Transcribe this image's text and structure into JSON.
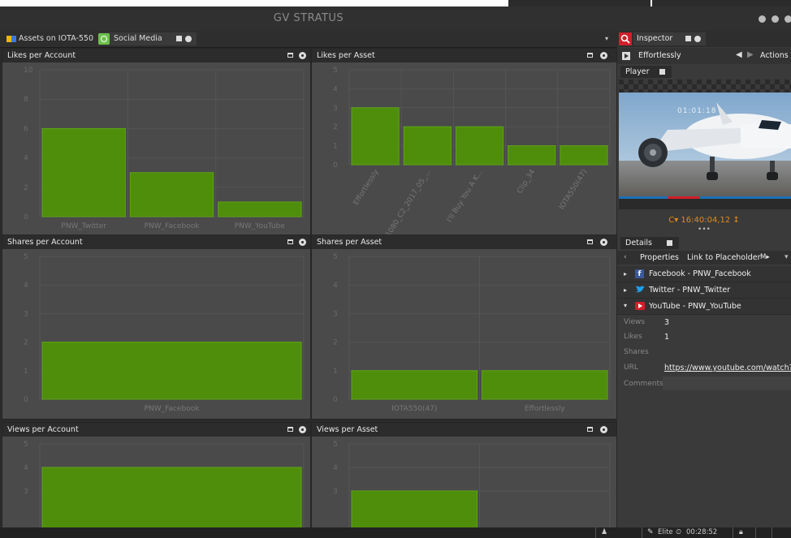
{
  "app": {
    "title": "GV STRATUS"
  },
  "tabs": [
    {
      "label": "Assets on IOTA-550",
      "active": false
    },
    {
      "label": "Social Media",
      "active": true
    }
  ],
  "colors": {
    "bar": "#4e8e0b",
    "bar_edge": "#5da514",
    "panel_bg": "#4a4a4a",
    "header_bg": "#2c2c2c",
    "grid": "#555555",
    "accent_red": "#d21e2b",
    "accent_green": "#6cc04a",
    "timecode": "#e08a1a"
  },
  "panels": [
    {
      "title": "Likes per Account",
      "chart_data": {
        "type": "bar",
        "categories": [
          "PNW_Twitter",
          "PNW_Facebook",
          "PNW_YouTube"
        ],
        "values": [
          6,
          3,
          1
        ],
        "ylim": [
          0,
          10
        ],
        "yticks": [
          0,
          2,
          4,
          6,
          8,
          10
        ],
        "rotate_labels": false
      }
    },
    {
      "title": "Likes per Asset",
      "chart_data": {
        "type": "bar",
        "categories": [
          "Effortlessly",
          "1080_C2_2017_05_...",
          "I'll Buy You A K...",
          "Clip_34",
          "IOTA550(47)"
        ],
        "values": [
          3,
          2,
          2,
          1,
          1
        ],
        "ylim": [
          0,
          5
        ],
        "yticks": [
          0,
          1,
          2,
          3,
          4,
          5
        ],
        "rotate_labels": true
      }
    },
    {
      "title": "Shares per Account",
      "chart_data": {
        "type": "bar",
        "categories": [
          "PNW_Facebook"
        ],
        "values": [
          2
        ],
        "ylim": [
          0,
          5
        ],
        "yticks": [
          0,
          1,
          2,
          3,
          4,
          5
        ],
        "rotate_labels": false
      }
    },
    {
      "title": "Shares per Asset",
      "chart_data": {
        "type": "bar",
        "categories": [
          "IOTA550(47)",
          "Effortlessly"
        ],
        "values": [
          1,
          1
        ],
        "ylim": [
          0,
          5
        ],
        "yticks": [
          0,
          1,
          2,
          3,
          4,
          5
        ],
        "rotate_labels": false
      }
    },
    {
      "title": "Views per Account",
      "chart_data": {
        "type": "bar",
        "categories": [
          ""
        ],
        "values": [
          4
        ],
        "ylim": [
          0,
          5
        ],
        "yticks": [
          3,
          4,
          5
        ],
        "rotate_labels": false
      }
    },
    {
      "title": "Views per Asset",
      "chart_data": {
        "type": "bar",
        "categories": [
          "",
          ""
        ],
        "values": [
          3,
          0
        ],
        "ylim": [
          0,
          5
        ],
        "yticks": [
          3,
          4,
          5
        ],
        "rotate_labels": false
      }
    }
  ],
  "inspector": {
    "tab_label": "Inspector",
    "asset_name": "Effortlessly",
    "actions_label": "Actions",
    "player_tab": "Player",
    "overlay_timecode": "01:01:18",
    "timecode": "C▾ 16:40:04,12 ↕",
    "details_tab": "Details",
    "sub_tabs": [
      "Properties",
      "Link to Placeholder",
      "M▸"
    ],
    "accounts": [
      {
        "label": "Facebook - PNW_Facebook",
        "icon": "facebook-icon",
        "expanded": false
      },
      {
        "label": "Twitter - PNW_Twitter",
        "icon": "twitter-icon",
        "expanded": false
      },
      {
        "label": "YouTube - PNW_YouTube",
        "icon": "youtube-icon",
        "expanded": true
      }
    ],
    "fields": [
      {
        "label": "Views",
        "value": "3"
      },
      {
        "label": "Likes",
        "value": "1"
      },
      {
        "label": "Shares",
        "value": ""
      },
      {
        "label": "URL",
        "value": "https://www.youtube.com/watch?v=..."
      },
      {
        "label": "Comments",
        "value": ""
      }
    ]
  },
  "status": {
    "user_label": "Elite",
    "clock": "00:28:52"
  }
}
